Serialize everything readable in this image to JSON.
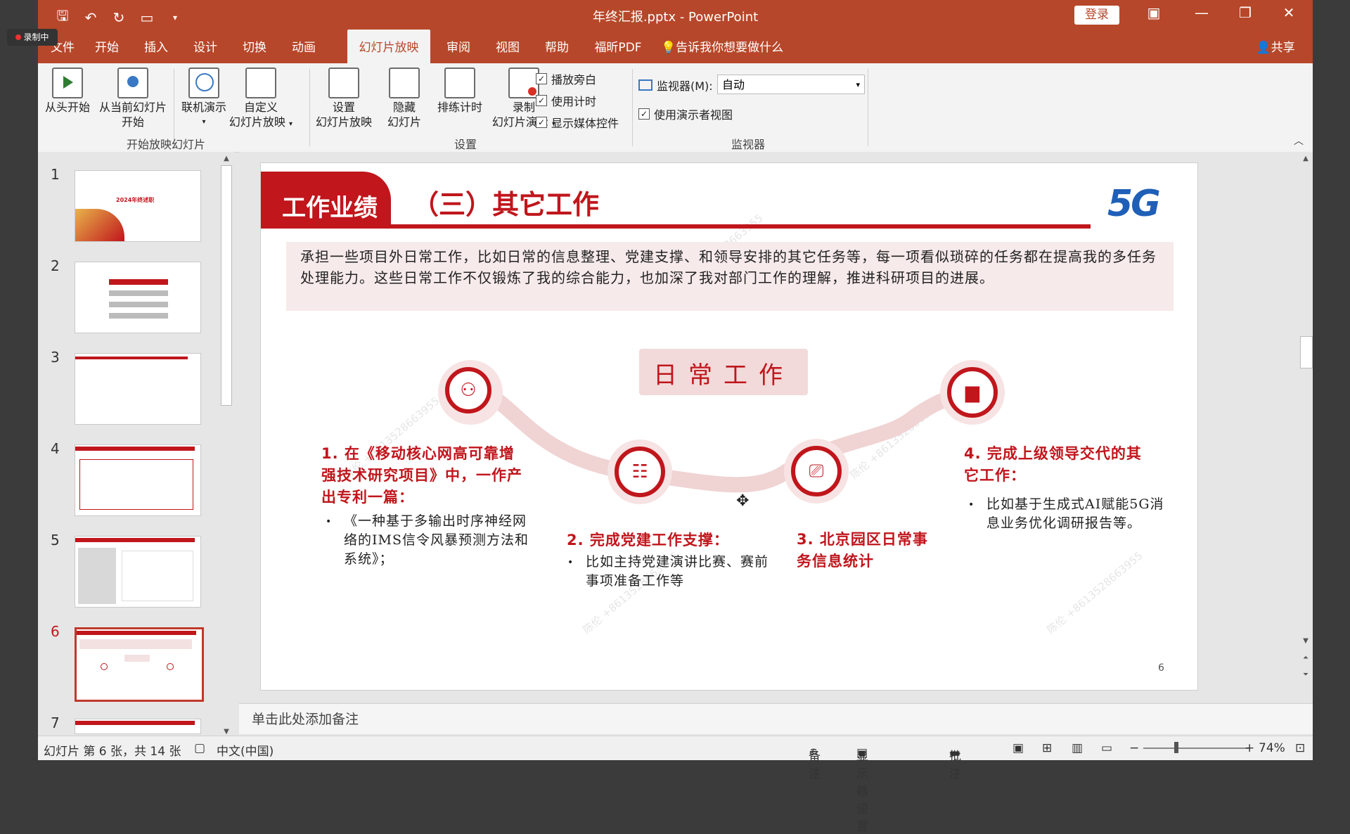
{
  "recording_badge": "录制中",
  "window": {
    "title": "年终汇报.pptx - PowerPoint",
    "login": "登录"
  },
  "tabs": [
    "文件",
    "开始",
    "插入",
    "设计",
    "切换",
    "动画",
    "幻灯片放映",
    "审阅",
    "视图",
    "帮助",
    "福昕PDF"
  ],
  "active_tab": "幻灯片放映",
  "tell_me": "告诉我你想要做什么",
  "share": "共享",
  "ribbon": {
    "from_start": "从头开始",
    "from_current_1": "从当前幻灯片",
    "from_current_2": "开始",
    "online_1": "联机演示",
    "custom_1": "自定义",
    "custom_2": "幻灯片放映",
    "group_start": "开始放映幻灯片",
    "setup_1": "设置",
    "setup_2": "幻灯片放映",
    "hide_1": "隐藏",
    "hide_2": "幻灯片",
    "rehearse": "排练计时",
    "record_1": "录制",
    "record_2": "幻灯片演示",
    "play_narration": "播放旁白",
    "use_timings": "使用计时",
    "show_media": "显示媒体控件",
    "group_setup": "设置",
    "monitor_label": "监视器(M):",
    "monitor_value": "自动",
    "presenter_view": "使用演示者视图",
    "group_monitor": "监视器"
  },
  "thumbnails": [
    "1",
    "2",
    "3",
    "4",
    "5",
    "6",
    "7"
  ],
  "selected_thumb": "6",
  "thumb1_title": "2024年终述职",
  "slide": {
    "header_left": "工作业绩",
    "header_right": "（三）其它工作",
    "logo": "5G",
    "intro": "承担一些项目外日常工作，比如日常的信息整理、党建支撑、和领导安排的其它任务等，每一项看似琐碎的任务都在提高我的多任务处理能力。这些日常工作不仅锻炼了我的综合能力，也加深了我对部门工作的理解，推进科研项目的进展。",
    "center_label": "日常工作",
    "item1_title": "1. 在《移动核心网高可靠增强技术研究项目》中，一作产出专利一篇：",
    "item1_body": "《一种基于多输出时序神经网络的IMS信令风暴预测方法和系统》；",
    "item2_title": "2. 完成党建工作支撑：",
    "item2_body": "比如主持党建演讲比赛、赛前事项准备工作等",
    "item3_title": "3. 北京园区日常事务信息统计",
    "item4_title": "4. 完成上级领导交代的其它工作：",
    "item4_body": "比如基于生成式AI赋能5G消息业务优化调研报告等。",
    "page_no": "6",
    "watermark": "陈伦 +8613528663955"
  },
  "notes_placeholder": "单击此处添加备注",
  "status": {
    "slide_info": "幻灯片 第 6 张，共 14 张",
    "language": "中文(中国)",
    "notes": "备注",
    "display_settings": "显示器设置",
    "comments": "批注",
    "zoom": "74%"
  },
  "colors": {
    "accent": "#b7472a",
    "slide_red": "#c0161c",
    "pink": "#f3e1e1"
  }
}
